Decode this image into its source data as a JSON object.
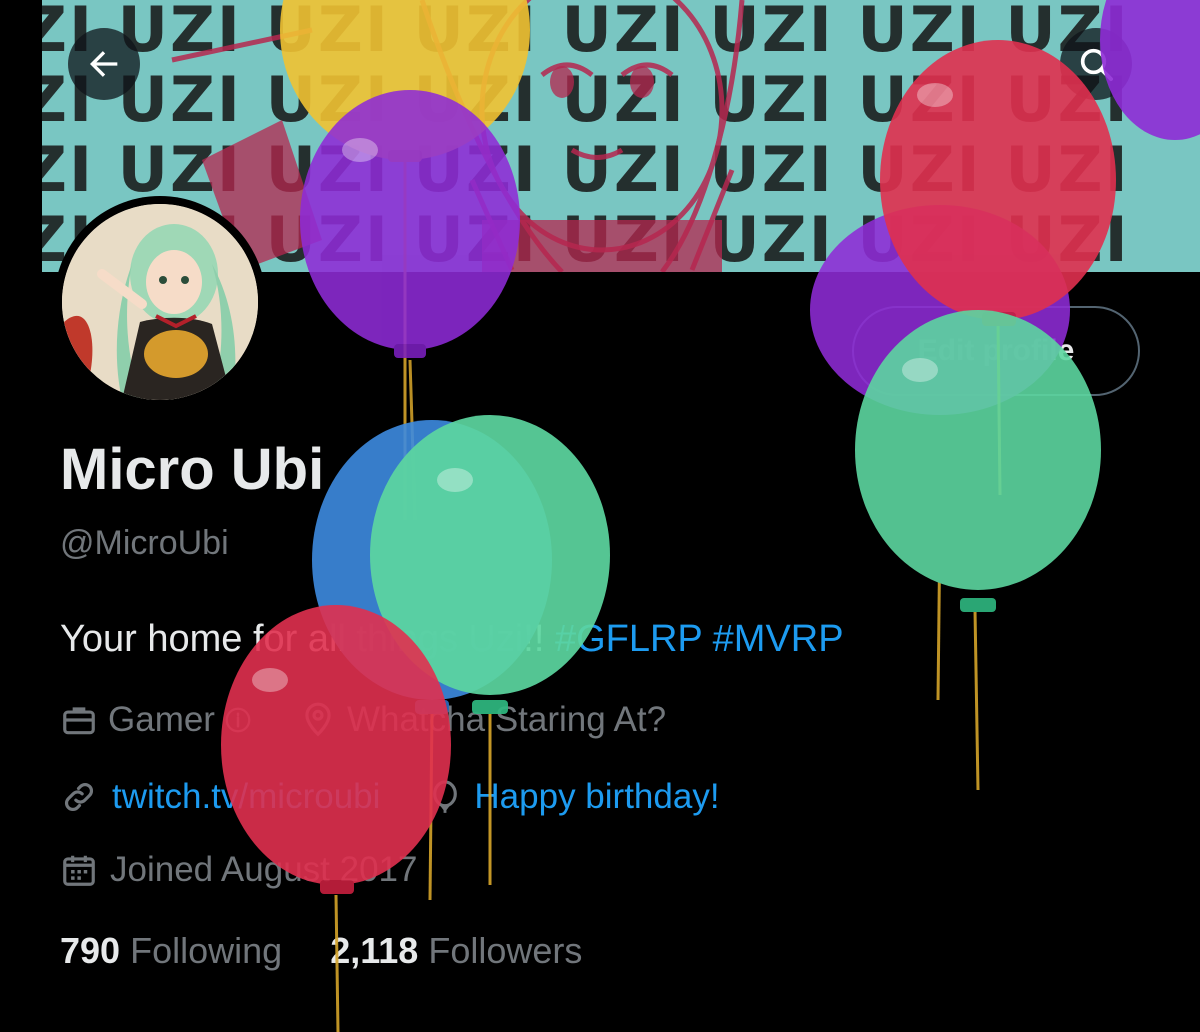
{
  "header": {
    "banner_text": "ZI UZI UZI UZI UZI UZI UZI UZI\nZI UZI UZI UZI UZI UZI UZI UZI\nZI UZI UZI UZI UZI UZI UZI UZI\nZI UZI UZI UZI UZI UZI UZI UZI",
    "back_icon": "arrow-left-icon",
    "search_icon": "search-icon"
  },
  "profile": {
    "edit_button_label": "Edit profile",
    "display_name": "Micro Ubi",
    "handle": "@MicroUbi",
    "bio_text": "Your home for all things Uzi!! ",
    "hashtags": [
      "#GFLRP",
      "#MVRP"
    ],
    "category": "Gamer",
    "location": "Whatcha Staring At?",
    "website": "twitch.tv/microubi",
    "birthday": "Happy birthday!",
    "joined": "Joined August 2017"
  },
  "stats": {
    "following_count": "790",
    "following_label": "Following",
    "followers_count": "2,118",
    "followers_label": "Followers"
  },
  "colors": {
    "background": "#000000",
    "accent": "#1d9bf0",
    "muted_text": "#71767b",
    "banner_teal": "#79c6c2"
  }
}
